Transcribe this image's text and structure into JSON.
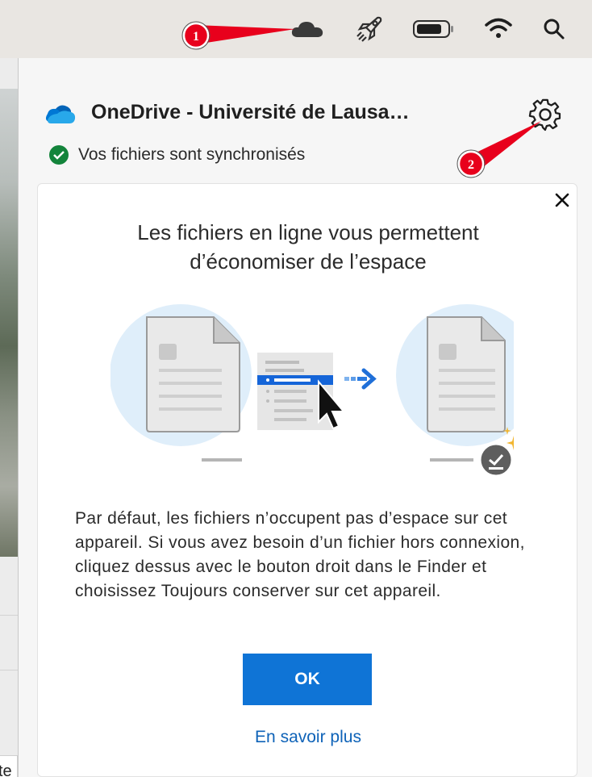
{
  "menubar": {
    "icons": [
      "onedrive-cloud-icon",
      "rocket-icon",
      "battery-icon",
      "wifi-icon",
      "search-icon"
    ]
  },
  "desktop": {
    "tab_fragment": "te"
  },
  "panel": {
    "title": "OneDrive - Université de Lausa…",
    "status": "Vos fichiers sont synchronisés"
  },
  "card": {
    "heading_line1": "Les fichiers en ligne vous permettent",
    "heading_line2": "d’économiser de l’espace",
    "body": "Par défaut, les fichiers n’occupent pas d’espace sur cet appareil. Si vous avez besoin d’un fichier hors connexion, cliquez dessus avec le bouton droit dans le Finder et choisissez Toujours conserver sur cet appareil.",
    "ok_label": "OK",
    "learn_more": "En savoir plus"
  },
  "annotations": [
    {
      "number": "1",
      "target": "onedrive-cloud-icon"
    },
    {
      "number": "2",
      "target": "settings-gear"
    }
  ],
  "colors": {
    "accent": "#0f74d6",
    "link": "#0f63b8",
    "success": "#13843b",
    "annotation": "#e8001c"
  }
}
